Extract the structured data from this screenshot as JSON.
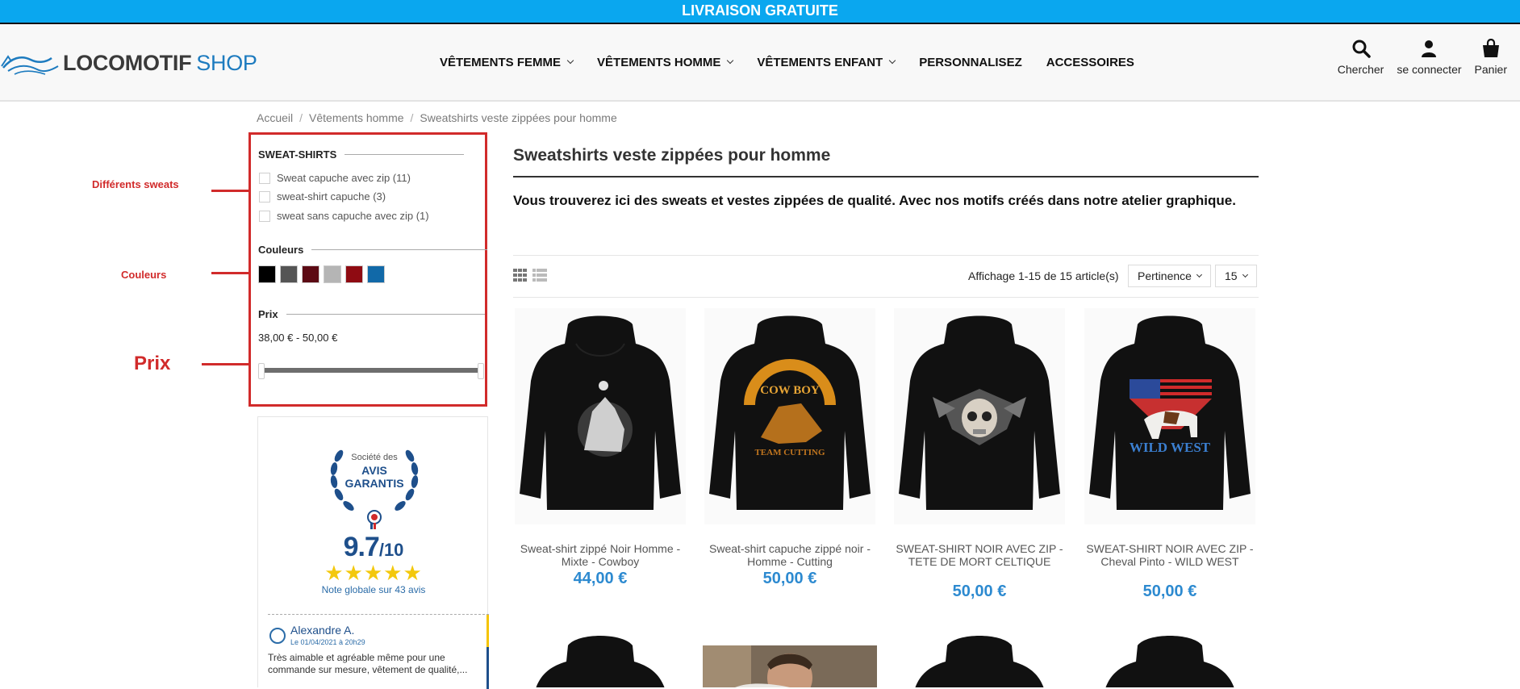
{
  "banner": "LIVRAISON GRATUITE",
  "logo": {
    "brand": "LOCOMOTIF",
    "shop": "SHOP"
  },
  "nav": [
    {
      "label": "VÊTEMENTS FEMME",
      "has_menu": true
    },
    {
      "label": "VÊTEMENTS HOMME",
      "has_menu": true
    },
    {
      "label": "VÊTEMENTS ENFANT",
      "has_menu": true
    },
    {
      "label": "PERSONNALISEZ",
      "has_menu": false
    },
    {
      "label": "ACCESSOIRES",
      "has_menu": false
    }
  ],
  "tools": {
    "search": {
      "label": "Chercher",
      "icon": "search-icon"
    },
    "account": {
      "label": "se connecter",
      "icon": "user-icon"
    },
    "cart": {
      "label": "Panier",
      "icon": "bag-icon"
    }
  },
  "breadcrumb": [
    "Accueil",
    "Vêtements homme",
    "Sweatshirts veste zippées pour homme"
  ],
  "filters": {
    "sweat": {
      "title": "SWEAT-SHIRTS",
      "options": [
        "Sweat capuche avec zip (11)",
        "sweat-shirt capuche (3)",
        "sweat sans capuche avec zip (1)"
      ]
    },
    "colors": {
      "title": "Couleurs",
      "swatches": [
        "#000000",
        "#555555",
        "#5c0a14",
        "#b5b5b5",
        "#8f0b12",
        "#1169a8"
      ]
    },
    "price": {
      "title": "Prix",
      "range": "38,00 € - 50,00 €"
    }
  },
  "annotations": {
    "sweats": "Différents sweats",
    "colors": "Couleurs",
    "price": "Prix",
    "color": "#d12b2b"
  },
  "reviews": {
    "badge_line1": "Société des",
    "badge_line2": "AVIS",
    "badge_line3": "GARANTIS",
    "score": "9.7",
    "score_max": "/10",
    "stars": "★★★★★",
    "summary": "Note globale sur 43 avis",
    "item": {
      "name": "Alexandre A.",
      "date": "Le 01/04/2021 à 20h29",
      "text": "Très aimable et agréable même pour une commande sur mesure, vêtement de qualité,..."
    }
  },
  "main": {
    "title": "Sweatshirts veste zippées pour homme",
    "intro": "Vous trouverez ici des sweats et vestes zippées de qualité. Avec nos motifs créés dans notre atelier graphique.",
    "results": "Affichage 1-15 de 15 article(s)",
    "sort": "Pertinence",
    "per_page": "15"
  },
  "products": [
    {
      "name": "Sweat-shirt zippé Noir Homme - Mixte - Cowboy",
      "price": "44,00 €",
      "design": "cowboy"
    },
    {
      "name": "Sweat-shirt capuche zippé noir - Homme - Cutting",
      "price": "50,00 €",
      "design": "cutting"
    },
    {
      "name": "SWEAT-SHIRT NOIR AVEC ZIP - TETE DE MORT CELTIQUE",
      "price": "50,00 €",
      "design": "skull"
    },
    {
      "name": "SWEAT-SHIRT NOIR AVEC ZIP - Cheval Pinto - WILD WEST",
      "price": "50,00 €",
      "design": "wildwest"
    }
  ]
}
